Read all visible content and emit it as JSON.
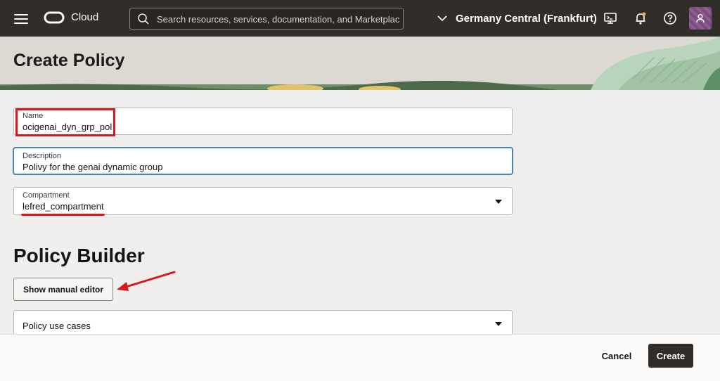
{
  "topbar": {
    "brand": "Cloud",
    "search_placeholder": "Search resources, services, documentation, and Marketplace",
    "region": "Germany Central (Frankfurt)",
    "icons": [
      "menu-icon",
      "cloud-shell-icon",
      "notifications-icon",
      "help-icon",
      "user-icon"
    ]
  },
  "page": {
    "title": "Create Policy"
  },
  "form": {
    "name": {
      "label": "Name",
      "value": "ocigenai_dyn_grp_pol"
    },
    "description": {
      "label": "Description",
      "value": "Polivy for the genai dynamic group"
    },
    "compartment": {
      "label": "Compartment",
      "value": "lefred_compartment"
    }
  },
  "policy_builder": {
    "title": "Policy Builder",
    "manual_editor_label": "Show manual editor",
    "use_cases_placeholder": "Policy use cases"
  },
  "footer": {
    "cancel_label": "Cancel",
    "create_label": "Create"
  },
  "colors": {
    "topbar": "#312d2a",
    "annotation": "#d8181f",
    "focus": "#4a86b4",
    "primary_button": "#312d2a"
  }
}
